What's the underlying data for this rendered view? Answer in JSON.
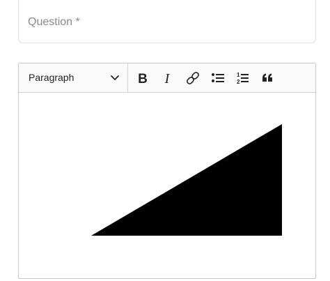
{
  "question": {
    "placeholder": "Question *"
  },
  "editor": {
    "toolbar": {
      "block_format": "Paragraph",
      "tools": [
        {
          "name": "bold",
          "glyph": "B"
        },
        {
          "name": "italic",
          "glyph": "I"
        },
        {
          "name": "link"
        },
        {
          "name": "bulleted-list"
        },
        {
          "name": "numbered-list"
        },
        {
          "name": "block-quote"
        }
      ]
    },
    "content": {
      "shape": "black right triangle",
      "color": "#000000"
    }
  }
}
